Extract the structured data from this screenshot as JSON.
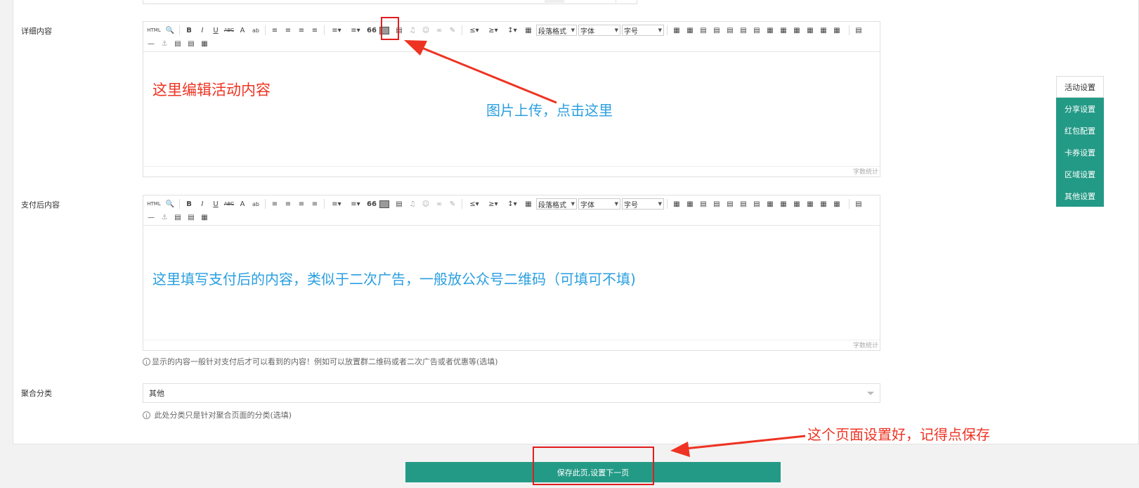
{
  "labels": {
    "detail": "详细内容",
    "after_pay": "支付后内容",
    "category": "聚合分类"
  },
  "toolbar": {
    "html": "HTML",
    "bold": "B",
    "italic": "I",
    "underline": "U",
    "strike": "ABC",
    "font_color": "A",
    "highlight": "ab",
    "quote": "66",
    "paragraph_select": "段落格式",
    "font_select": "字体",
    "size_select": "字号"
  },
  "editors": {
    "detail": {
      "word_count": "字数统计"
    },
    "after_pay": {
      "word_count": "字数统计"
    }
  },
  "after_pay_hint": "显示的内容一般针对支付后才可以看到的内容！例如可以放置群二维码或者二次广告或者优惠等(选填)",
  "category": {
    "value": "其他",
    "hint": "此处分类只是针对聚合页面的分类(选填)"
  },
  "side_nav": {
    "items": [
      "活动设置",
      "分享设置",
      "红包配置",
      "卡券设置",
      "区域设置",
      "其他设置"
    ],
    "active_index": 0
  },
  "save_button": "保存此页,设置下一页",
  "annotations": {
    "edit_content": "这里编辑活动内容",
    "image_upload": "图片上传，点击这里",
    "after_pay_content": "这里填写支付后的内容，类似于二次广告，一般放公众号二维码（可填可不填)",
    "remember_save": "这个页面设置好，记得点保存"
  },
  "colors": {
    "accent": "#239a86",
    "annotation_red": "#ee3322",
    "annotation_blue": "#2a9fe0"
  }
}
